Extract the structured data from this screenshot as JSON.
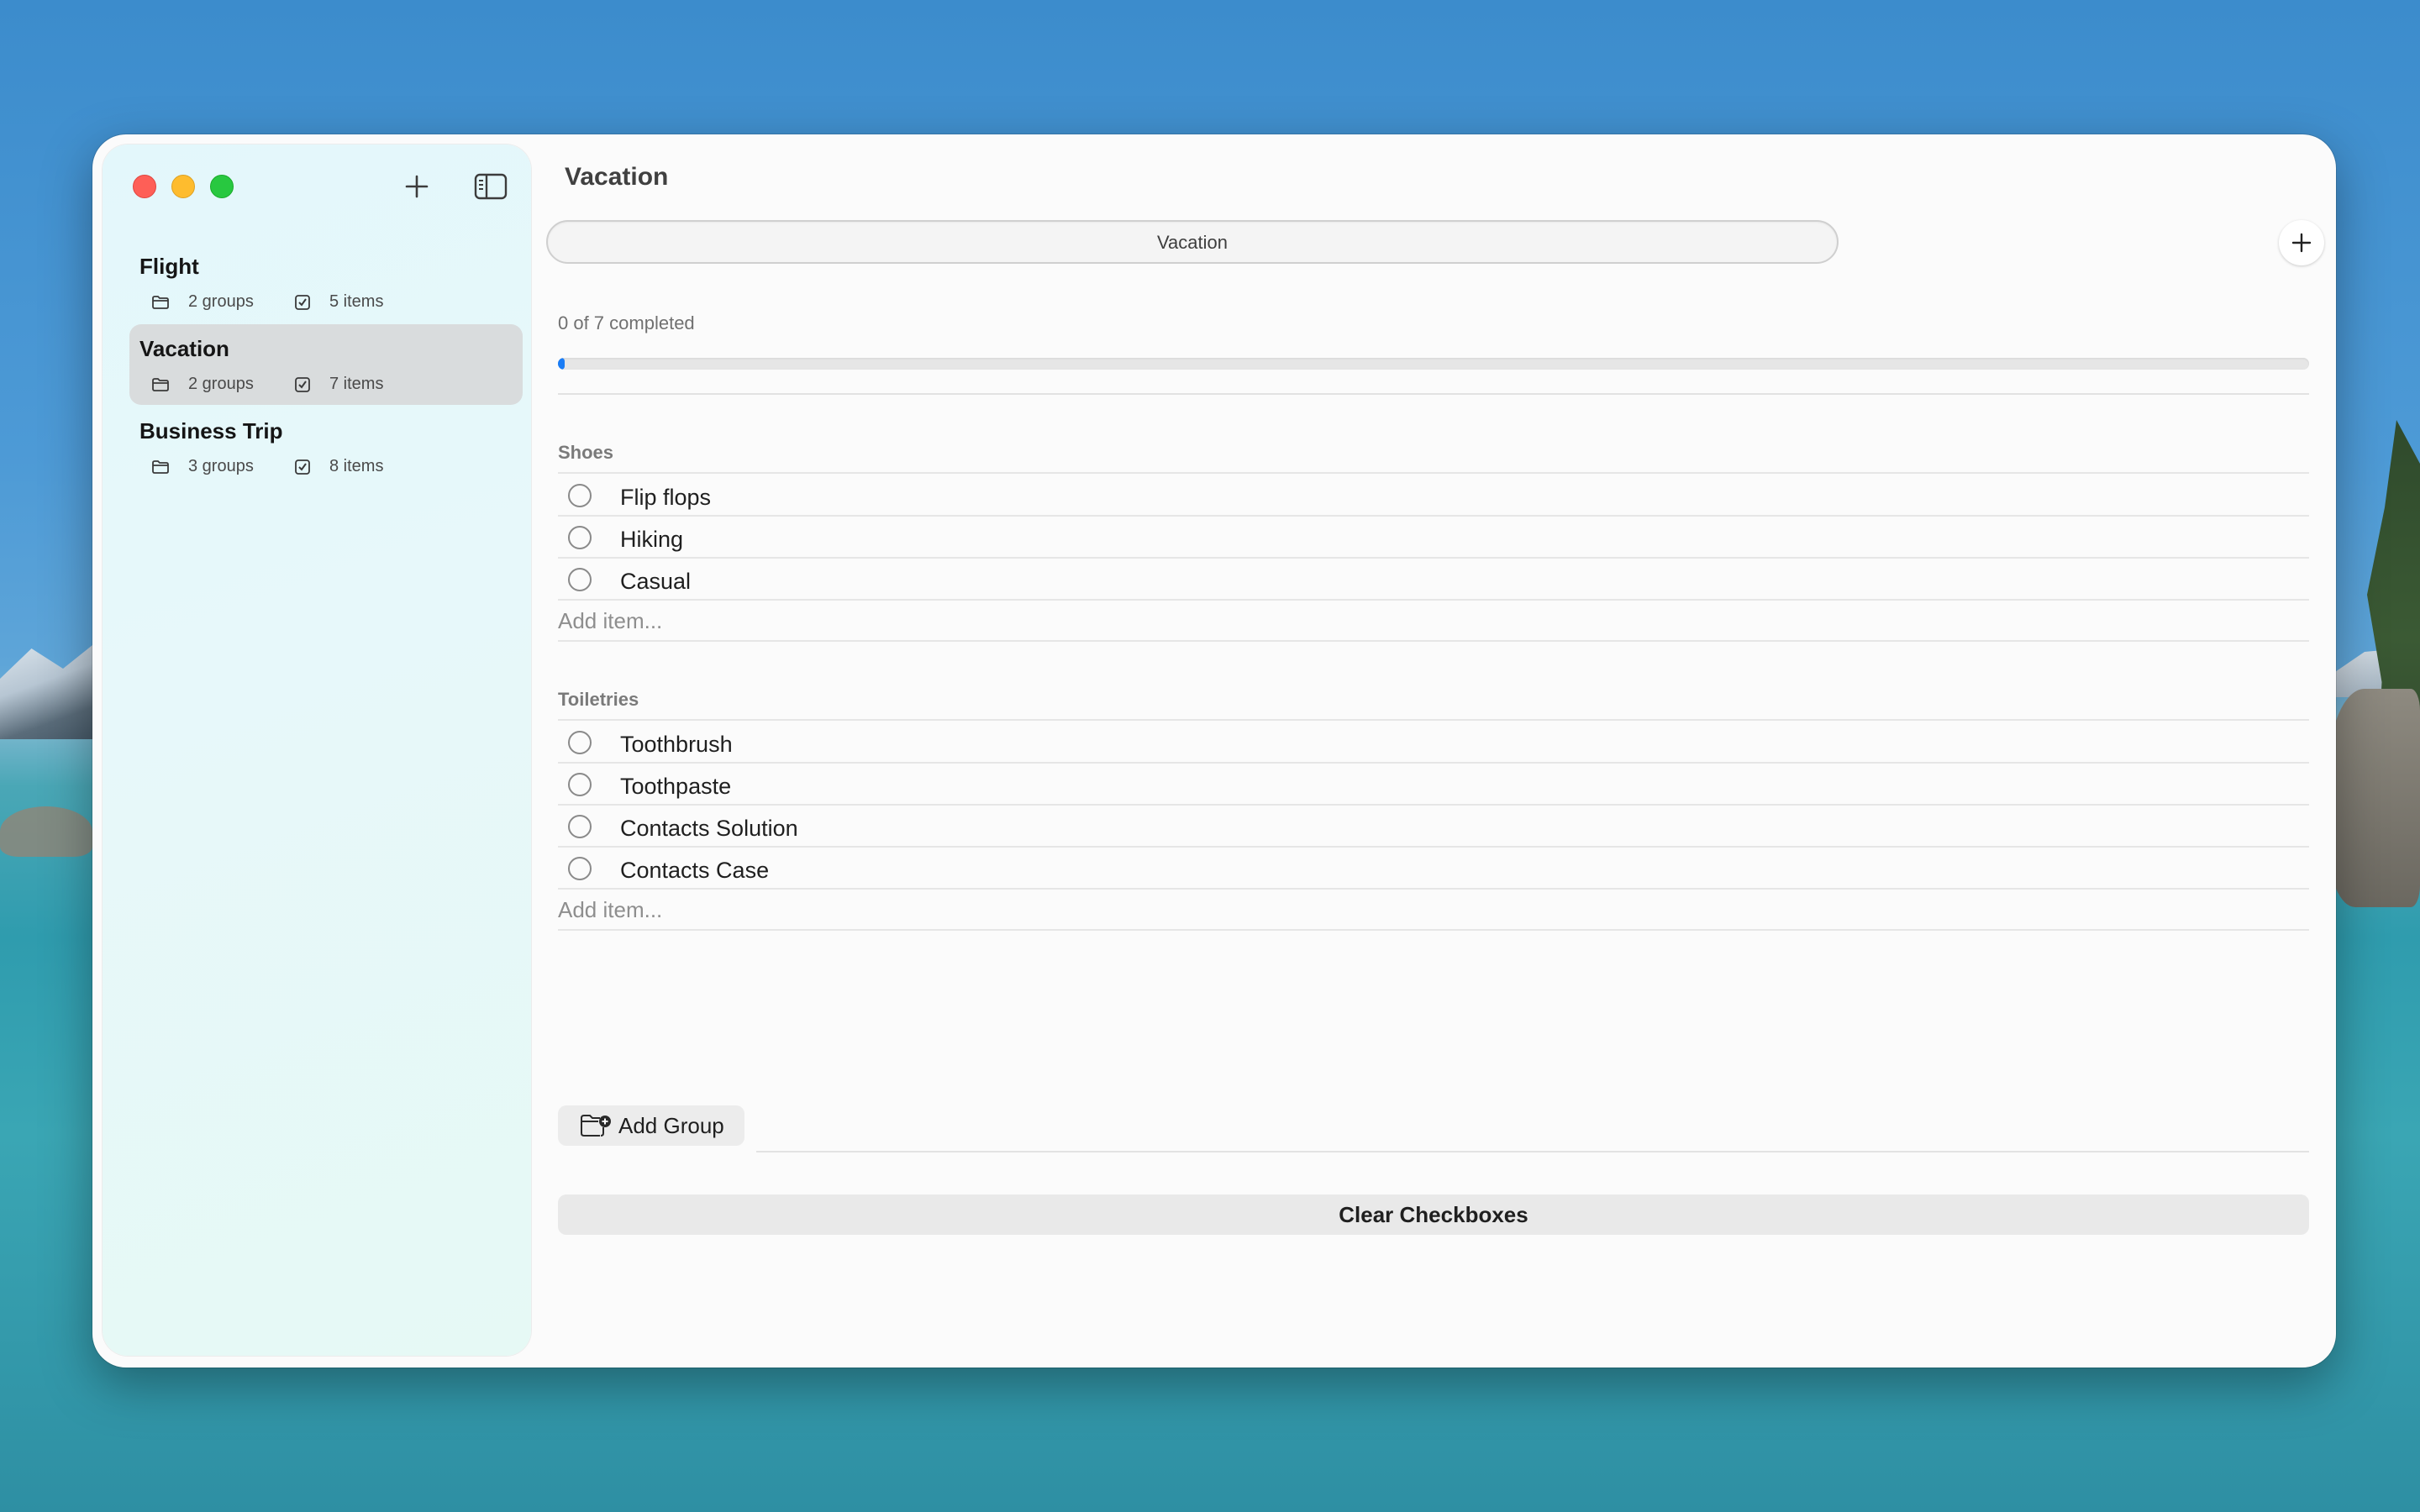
{
  "sidebar": {
    "items": [
      {
        "title": "Flight",
        "groups": "2 groups",
        "items": "5 items"
      },
      {
        "title": "Vacation",
        "groups": "2 groups",
        "items": "7 items"
      },
      {
        "title": "Business Trip",
        "groups": "3 groups",
        "items": "8 items"
      }
    ]
  },
  "main": {
    "title": "Vacation",
    "tabs": [
      {
        "label": "Vacation"
      }
    ],
    "progress": {
      "text": "0 of 7 completed",
      "percent_label": "0%",
      "fraction": 0.0
    },
    "groups": [
      {
        "name": "Shoes",
        "items": [
          "Flip flops",
          "Hiking",
          "Casual"
        ],
        "add_placeholder": "Add item..."
      },
      {
        "name": "Toiletries",
        "items": [
          "Toothbrush",
          "Toothpaste",
          "Contacts Solution",
          "Contacts Case"
        ],
        "add_placeholder": "Add item..."
      }
    ],
    "add_group_label": "Add Group",
    "clear_label": "Clear Checkboxes"
  },
  "colors": {
    "accent": "#1a7cf5",
    "destructive": "#f0433a",
    "selected_row": "#d9dcdd"
  },
  "icons": {
    "sidebar_add": "plus-icon",
    "sidebar_toggle": "sidebar-toggle-icon",
    "groups_meta": "folder-icon",
    "items_meta": "checkmark-square-icon",
    "group_delete": "trash-icon",
    "item_remove": "minus-circle-icon",
    "add_group": "folder-badge-plus-icon"
  }
}
